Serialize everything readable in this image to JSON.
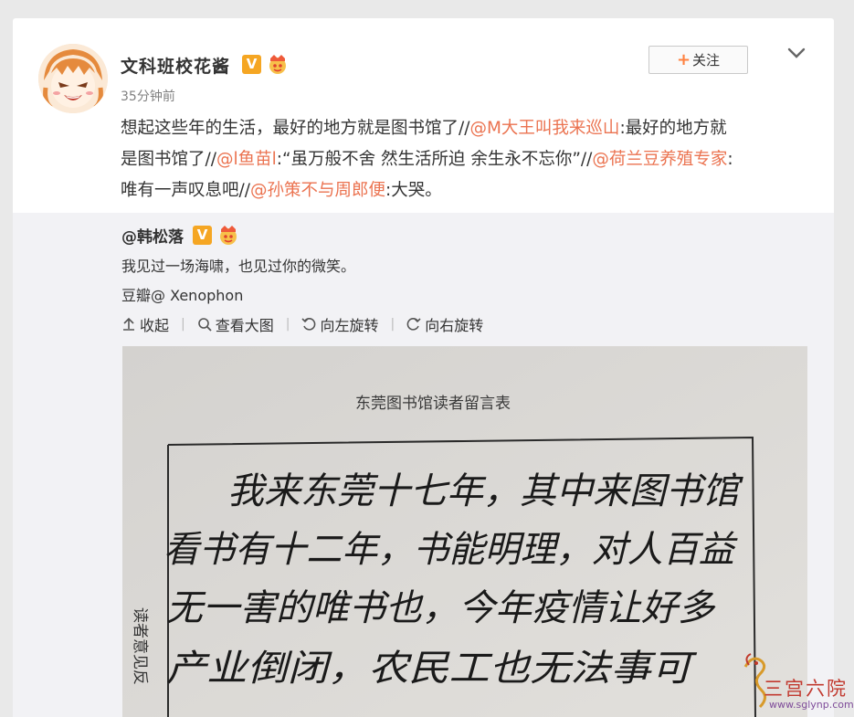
{
  "post": {
    "username": "文科班校花酱",
    "verified_badge": "V",
    "timestamp": "35分钟前",
    "follow_label": "关注",
    "follow_plus": "+",
    "text_line1_a": "想起这些年的生活，最好的地方就是图书馆了//",
    "mention1": "@M大王叫我来巡山",
    "text_line1_b": ":最好的地方就",
    "text_line2_a": "是图书馆了//",
    "mention2": "@l鱼苗l",
    "text_line2_b": ":“虽万般不舍 然生活所迫 余生永不忘你”//",
    "mention3": "@荷兰豆养殖专家",
    "text_line2_c": ":",
    "text_line3_a": "唯有一声叹息吧//",
    "mention4": "@孙策不与周郎便",
    "text_line3_b": ":大哭。"
  },
  "repost": {
    "author": "@韩松落",
    "verified_badge": "V",
    "text": "我见过一场海啸，也见过你的微笑。",
    "source": "豆瓣@ Xenophon",
    "toolbar": {
      "collapse": "收起",
      "view_large": "查看大图",
      "rotate_left": "向左旋转",
      "rotate_right": "向右旋转"
    }
  },
  "photo": {
    "form_title": "东莞图书馆读者留言表",
    "side_label": "读者意见反",
    "handwriting": [
      "我来东莞十七年，其中来图书馆",
      "看书有十二年，书能明理，对人百益",
      "无一害的唯书也，今年疫情让好多",
      "产业倒闭，农民工也无法事可"
    ]
  },
  "watermark": {
    "text": "三宫六院",
    "url": "www.sglynp.com"
  },
  "colors": {
    "mention": "#eb7350",
    "follow_plus": "#ff8140",
    "badge": "#f5a623",
    "repost_bg": "#f2f2f5"
  }
}
